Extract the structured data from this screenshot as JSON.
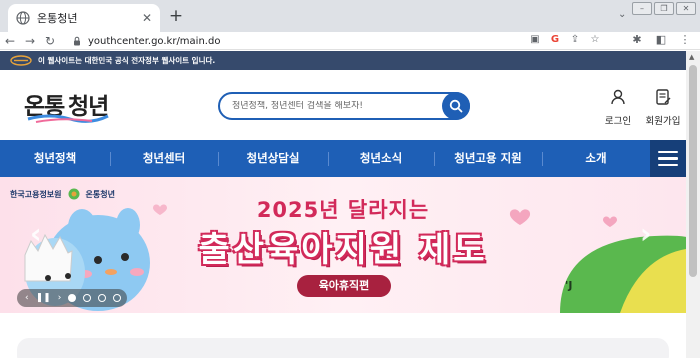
{
  "browser": {
    "tab_title": "온통청년",
    "tab_close": "✕",
    "new_tab": "+",
    "url": "youthcenter.go.kr/main.do"
  },
  "gov_notice": "이 웹사이트는 대한민국 공식 전자정부 웹사이트 입니다.",
  "header": {
    "logo_text": "온통청년",
    "search_placeholder": "청년정책, 청년센터 검색을 해보자!",
    "login_label": "로그인",
    "signup_label": "회원가입"
  },
  "nav": {
    "items": [
      {
        "label": "청년정책"
      },
      {
        "label": "청년센터"
      },
      {
        "label": "청년상담실"
      },
      {
        "label": "청년소식"
      },
      {
        "label": "청년고용 지원"
      },
      {
        "label": "소개"
      }
    ]
  },
  "hero": {
    "org_label": "한국고용정보원",
    "brand_label": "온통청년",
    "headline_line1": "2025년 달라지는",
    "headline_line2": "출산육아지원 제도",
    "pill_label": "육아휴직편",
    "slide_count": 4,
    "active_slide": 1
  },
  "colors": {
    "brand_blue": "#1e5fb6",
    "gov_bar": "#364a6c",
    "headline_pink": "#d22a5a",
    "pill_red": "#a8213f"
  }
}
